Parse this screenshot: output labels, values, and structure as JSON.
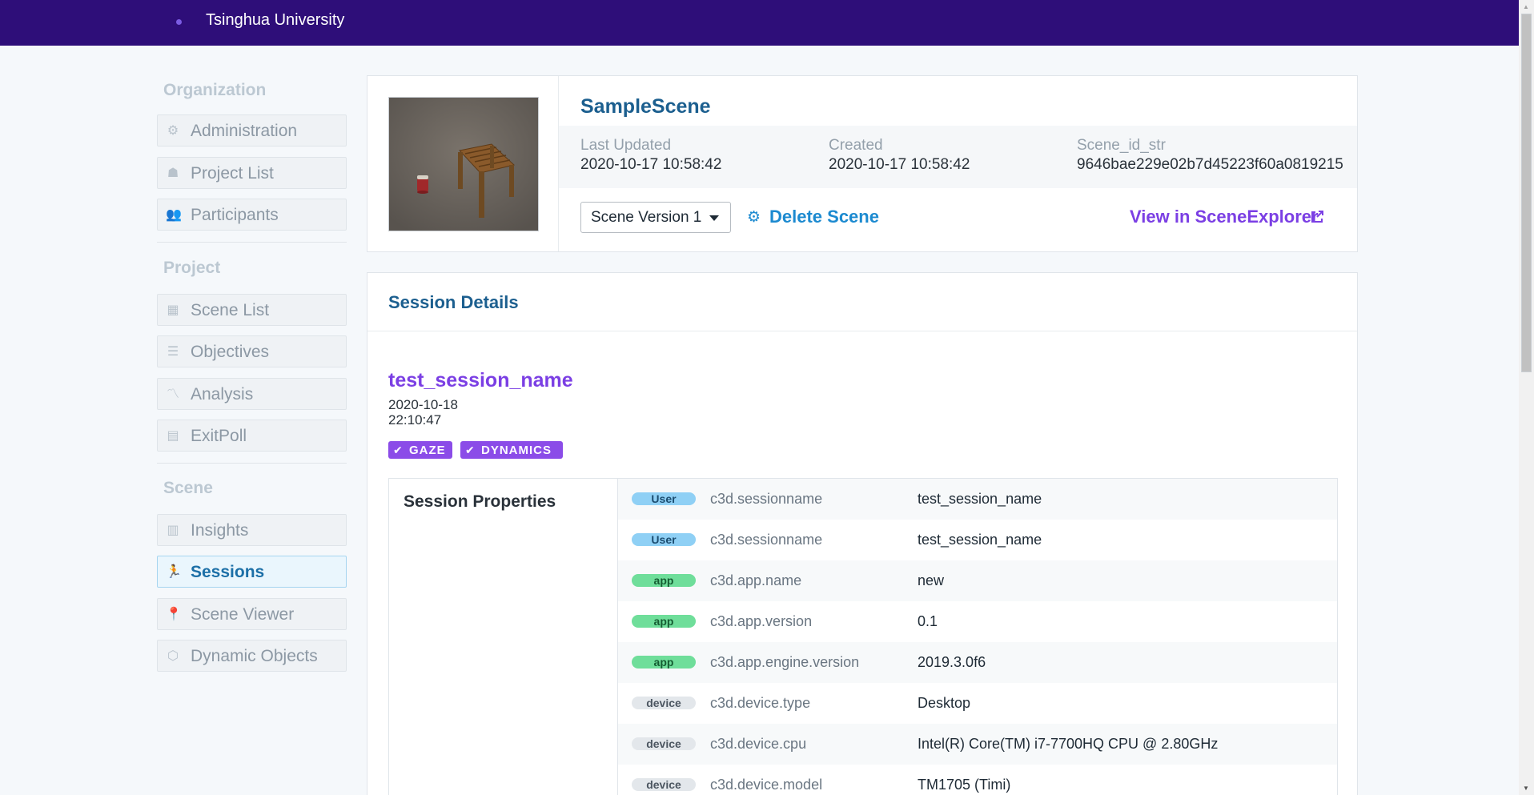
{
  "header": {
    "org_name": "Tsinghua University"
  },
  "sidebar": {
    "sections": [
      {
        "title": "Organization"
      },
      {
        "title": "Project"
      },
      {
        "title": "Scene"
      }
    ],
    "items": [
      {
        "label": "Administration",
        "icon": "gear-icon"
      },
      {
        "label": "Project List",
        "icon": "projects-icon"
      },
      {
        "label": "Participants",
        "icon": "users-icon"
      },
      {
        "label": "Scene List",
        "icon": "grid-icon"
      },
      {
        "label": "Objectives",
        "icon": "checklist-icon"
      },
      {
        "label": "Analysis",
        "icon": "line-chart-icon"
      },
      {
        "label": "ExitPoll",
        "icon": "form-icon"
      },
      {
        "label": "Insights",
        "icon": "insights-icon"
      },
      {
        "label": "Sessions",
        "icon": "running-person-icon",
        "active": true
      },
      {
        "label": "Scene Viewer",
        "icon": "pin-icon"
      },
      {
        "label": "Dynamic Objects",
        "icon": "cube-icon"
      }
    ]
  },
  "scene": {
    "title": "SampleScene",
    "last_updated_label": "Last Updated",
    "last_updated": "2020-10-17 10:58:42",
    "created_label": "Created",
    "created": "2020-10-17 10:58:42",
    "scene_id_label": "Scene_id_str",
    "scene_id": "9646bae229e02b7d45223f60a0819215",
    "version_select": "Scene Version 1",
    "delete_label": "Delete Scene",
    "view_label": "View in SceneExplorer"
  },
  "session": {
    "header": "Session Details",
    "name": "test_session_name",
    "date": "2020-10-18",
    "time": "22:10:47",
    "tags": [
      "GAZE",
      "DYNAMICS"
    ],
    "properties_title": "Session Properties",
    "properties": [
      {
        "badge": "User",
        "key": "c3d.sessionname",
        "value": "test_session_name"
      },
      {
        "badge": "User",
        "key": "c3d.sessionname",
        "value": "test_session_name"
      },
      {
        "badge": "app",
        "key": "c3d.app.name",
        "value": "new"
      },
      {
        "badge": "app",
        "key": "c3d.app.version",
        "value": "0.1"
      },
      {
        "badge": "app",
        "key": "c3d.app.engine.version",
        "value": "2019.3.0f6"
      },
      {
        "badge": "device",
        "key": "c3d.device.type",
        "value": "Desktop"
      },
      {
        "badge": "device",
        "key": "c3d.device.cpu",
        "value": "Intel(R) Core(TM) i7-7700HQ CPU @ 2.80GHz"
      },
      {
        "badge": "device",
        "key": "c3d.device.model",
        "value": "TM1705 (Timi)"
      }
    ]
  },
  "colors": {
    "topbar": "#2e0e79",
    "link_blue": "#1c8ad0",
    "accent_purple": "#7b3fe4",
    "heading_blue": "#1c5f8f"
  }
}
